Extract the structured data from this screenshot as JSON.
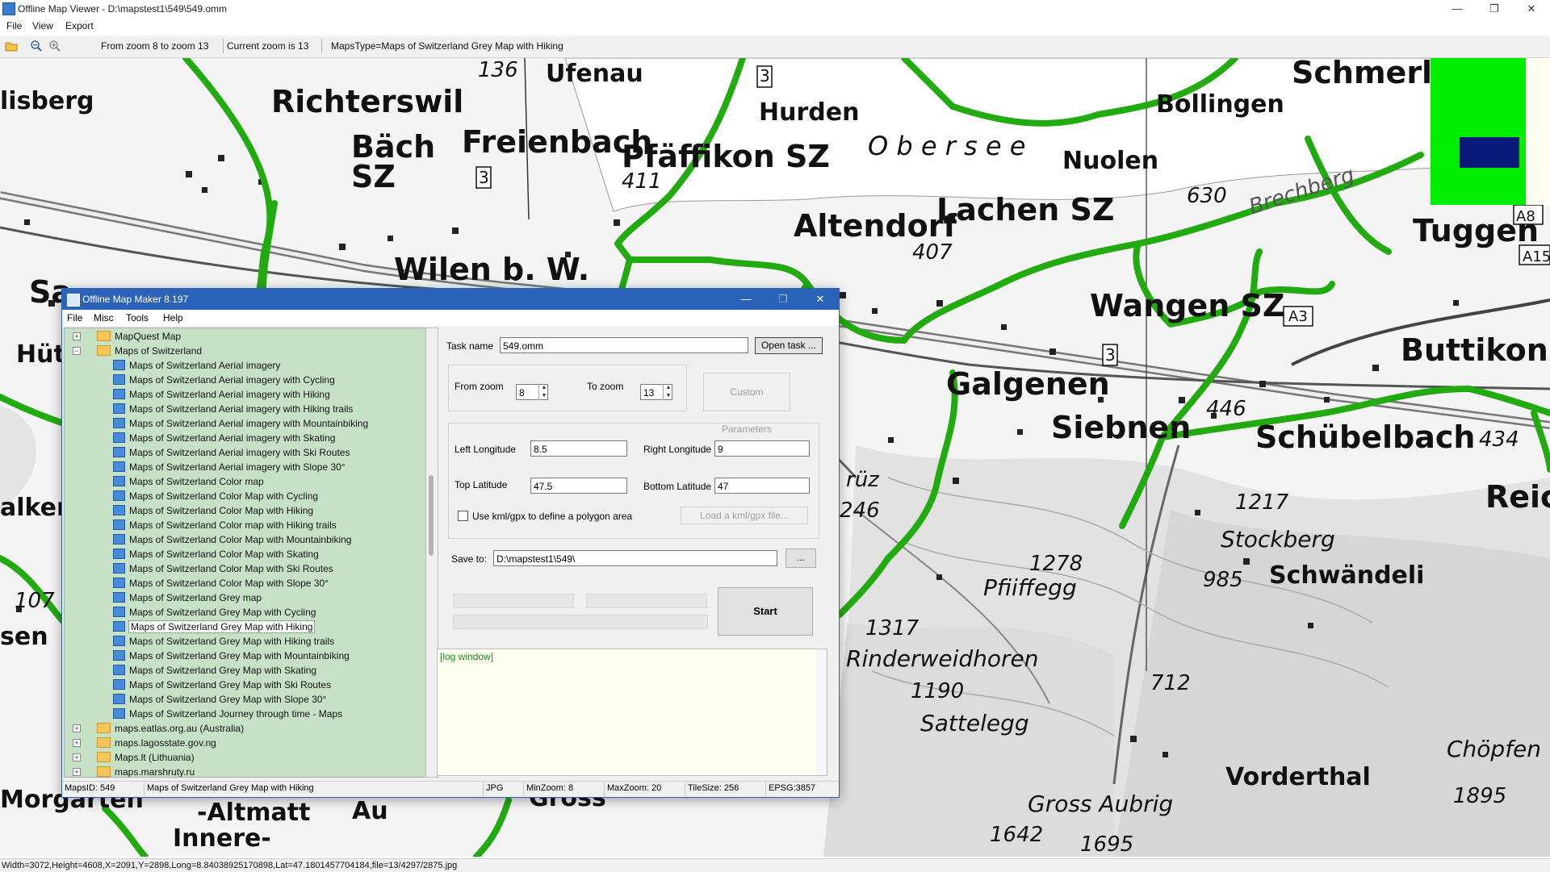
{
  "window": {
    "title": "Offline Map Viewer - D:\\mapstest1\\549\\549.omm",
    "minimize": "—",
    "maximize": "❐",
    "close": "✕"
  },
  "menu": {
    "file": "File",
    "view": "View",
    "export": "Export"
  },
  "toolbar": {
    "open_icon": "folder-open-icon",
    "zoom_out_icon": "zoom-out-icon",
    "zoom_in_icon": "zoom-in-icon",
    "zoom_range": "From zoom 8 to zoom 13",
    "current_zoom": "Current zoom is 13",
    "maps_type": "MapsType=Maps of Switzerland Grey Map with Hiking"
  },
  "map_labels": [
    "Richterswil",
    "Bäch",
    "SZ",
    "Freienbach",
    "Pfäffikon SZ",
    "Hurden",
    "Ufenau",
    "136",
    "Bollingen",
    "Schmerl",
    "O b e r s e e",
    "Nuolen",
    "Altendorf",
    "Lachen SZ",
    "Tuggen",
    "Wilen b. W.",
    "Wangen SZ",
    "Galgenen",
    "Siebnen",
    "Schübelbach",
    "Buttikon",
    "434",
    "Reich",
    "1217",
    "Stockberg",
    "985",
    "Schwändeli",
    "1278",
    "Pfiiffegg",
    "1317",
    "Rinderweidhoren",
    "1190",
    "Sattelegg",
    "712",
    "Vorderthal",
    "Gross Aubrig",
    "1642",
    "1695",
    "Chöpfen",
    "1895",
    "Morgarten",
    "-Altmatt",
    "Innere-",
    "Au",
    "Gross",
    "lisberg",
    "Hüt",
    "alkenb",
    "107",
    "sen",
    "411",
    "407",
    "630",
    "446",
    "246",
    "rüz",
    "Sa",
    "A8",
    "A15",
    "A3",
    "3",
    "3",
    "3",
    "Brechberg"
  ],
  "statusbar": {
    "text": "Width=3072,Height=4608,X=2091,Y=2898,Long=8.84038925170898,Lat=47.1801457704184,file=13/4297/2875.jpg"
  },
  "dialog": {
    "title": "Offline Map Maker 8.197",
    "menu": {
      "file": "File",
      "misc": "Misc",
      "tools": "Tools",
      "help": "Help"
    },
    "tree": {
      "items": [
        {
          "label": "MapQuest Map",
          "type": "folder",
          "expand": "+"
        },
        {
          "label": "Maps of Switzerland",
          "type": "folder",
          "expand": "−"
        },
        {
          "label": "Maps of Switzerland Aerial imagery",
          "type": "map"
        },
        {
          "label": "Maps of Switzerland Aerial imagery with Cycling",
          "type": "map"
        },
        {
          "label": "Maps of Switzerland Aerial imagery with Hiking",
          "type": "map"
        },
        {
          "label": "Maps of Switzerland Aerial imagery with Hiking trails",
          "type": "map"
        },
        {
          "label": "Maps of Switzerland Aerial imagery with Mountainbiking",
          "type": "map"
        },
        {
          "label": "Maps of Switzerland Aerial imagery with Skating",
          "type": "map"
        },
        {
          "label": "Maps of Switzerland Aerial imagery with Ski Routes",
          "type": "map"
        },
        {
          "label": "Maps of Switzerland Aerial imagery with Slope 30°",
          "type": "map"
        },
        {
          "label": "Maps of Switzerland Color map",
          "type": "map"
        },
        {
          "label": "Maps of Switzerland Color Map with Cycling",
          "type": "map"
        },
        {
          "label": "Maps of Switzerland Color Map with Hiking",
          "type": "map"
        },
        {
          "label": "Maps of Switzerland Color map with Hiking trails",
          "type": "map"
        },
        {
          "label": "Maps of Switzerland Color Map with Mountainbiking",
          "type": "map"
        },
        {
          "label": "Maps of Switzerland Color Map with Skating",
          "type": "map"
        },
        {
          "label": "Maps of Switzerland Color Map with Ski Routes",
          "type": "map"
        },
        {
          "label": "Maps of Switzerland Color Map with Slope 30°",
          "type": "map"
        },
        {
          "label": "Maps of Switzerland Grey map",
          "type": "map"
        },
        {
          "label": "Maps of Switzerland Grey Map with Cycling",
          "type": "map"
        },
        {
          "label": "Maps of Switzerland Grey Map with Hiking",
          "type": "map",
          "selected": true
        },
        {
          "label": "Maps of Switzerland Grey Map with Hiking trails",
          "type": "map"
        },
        {
          "label": "Maps of Switzerland Grey Map with Mountainbiking",
          "type": "map"
        },
        {
          "label": "Maps of Switzerland Grey Map with Skating",
          "type": "map"
        },
        {
          "label": "Maps of Switzerland Grey Map with Ski Routes",
          "type": "map"
        },
        {
          "label": "Maps of Switzerland Grey Map with Slope 30°",
          "type": "map"
        },
        {
          "label": "Maps of Switzerland Journey through time - Maps",
          "type": "map"
        },
        {
          "label": "maps.eatlas.org.au (Australia)",
          "type": "folder",
          "expand": "+"
        },
        {
          "label": "maps.lagosstate.gov.ng",
          "type": "folder",
          "expand": "+"
        },
        {
          "label": "Maps.lt (Lithuania)",
          "type": "folder",
          "expand": "+"
        },
        {
          "label": "maps.marshruty.ru",
          "type": "folder",
          "expand": "+"
        }
      ]
    },
    "task_name_label": "Task name",
    "task_name_value": "549.omm",
    "open_task": "Open task ...",
    "from_zoom_label": "From zoom",
    "from_zoom_value": "8",
    "to_zoom_label": "To zoom",
    "to_zoom_value": "13",
    "custom_params": "Custom Parameters",
    "left_lon_label": "Left Longitude",
    "left_lon_value": "8.5",
    "right_lon_label": "Right Longitude",
    "right_lon_value": "9",
    "top_lat_label": "Top Latitude",
    "top_lat_value": "47.5",
    "bottom_lat_label": "Bottom Latitude",
    "bottom_lat_value": "47",
    "use_kml_label": "Use kml/gpx to define a polygon area",
    "load_kml": "Load a kml/gpx file...",
    "save_to_label": "Save to:",
    "save_to_value": "D:\\mapstest1\\549\\",
    "browse": "...",
    "start": "Start",
    "log": "[log window]",
    "status": {
      "maps_id": "MapsID: 549",
      "maps_name": "Maps of Switzerland Grey Map with Hiking",
      "format": "JPG",
      "min_zoom": "MinZoom: 8",
      "max_zoom": "MaxZoom: 20",
      "tile_size": "TileSize: 256",
      "epsg": "EPSG:3857"
    }
  },
  "colors": {
    "route": "#22aa11",
    "dialog_title": "#2b63b8",
    "tree_bg": "#c7e1c7",
    "log_bg": "#fffff0",
    "minimap": "#00ee00",
    "minimap_rect": "#0a1a7a"
  }
}
